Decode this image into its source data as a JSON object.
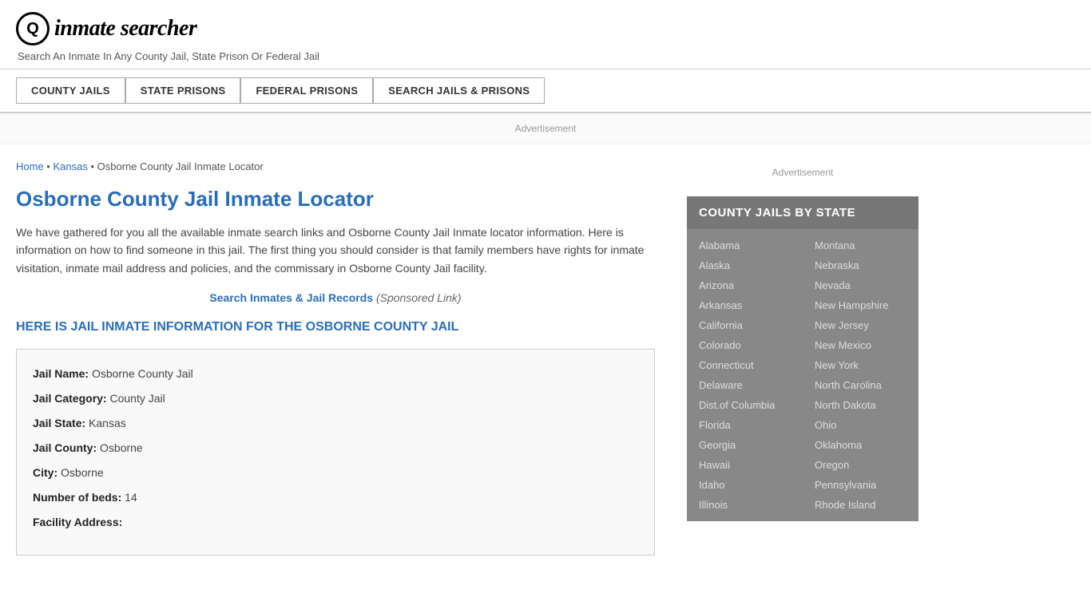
{
  "header": {
    "logo_text": "inmate searcher",
    "logo_icon": "Q",
    "tagline": "Search An Inmate In Any County Jail, State Prison Or Federal Jail"
  },
  "nav": {
    "items": [
      {
        "label": "COUNTY JAILS",
        "name": "county-jails-nav"
      },
      {
        "label": "STATE PRISONS",
        "name": "state-prisons-nav"
      },
      {
        "label": "FEDERAL PRISONS",
        "name": "federal-prisons-nav"
      },
      {
        "label": "SEARCH JAILS & PRISONS",
        "name": "search-jails-nav"
      }
    ]
  },
  "ad_label": "Advertisement",
  "breadcrumb": {
    "home": "Home",
    "state": "Kansas",
    "current": "Osborne County Jail Inmate Locator"
  },
  "page_title": "Osborne County Jail Inmate Locator",
  "body_text": "We have gathered for you all the available inmate search links and Osborne County Jail Inmate locator information. Here is information on how to find someone in this jail. The first thing you should consider is that family members have rights for inmate visitation, inmate mail address and policies, and the commissary in Osborne County Jail facility.",
  "sponsored": {
    "link_text": "Search Inmates & Jail Records",
    "tag": "(Sponsored Link)"
  },
  "section_heading": "HERE IS JAIL INMATE INFORMATION FOR THE OSBORNE COUNTY JAIL",
  "jail_info": {
    "name_label": "Jail Name:",
    "name_value": "Osborne County Jail",
    "category_label": "Jail Category:",
    "category_value": "County Jail",
    "state_label": "Jail State:",
    "state_value": "Kansas",
    "county_label": "Jail County:",
    "county_value": "Osborne",
    "city_label": "City:",
    "city_value": "Osborne",
    "beds_label": "Number of beds:",
    "beds_value": "14",
    "address_label": "Facility Address:"
  },
  "sidebar": {
    "ad_label": "Advertisement",
    "county_jails_header": "COUNTY JAILS BY STATE",
    "states_col1": [
      "Alabama",
      "Alaska",
      "Arizona",
      "Arkansas",
      "California",
      "Colorado",
      "Connecticut",
      "Delaware",
      "Dist.of Columbia",
      "Florida",
      "Georgia",
      "Hawaii",
      "Idaho",
      "Illinois"
    ],
    "states_col2": [
      "Montana",
      "Nebraska",
      "Nevada",
      "New Hampshire",
      "New Jersey",
      "New Mexico",
      "New York",
      "North Carolina",
      "North Dakota",
      "Ohio",
      "Oklahoma",
      "Oregon",
      "Pennsylvania",
      "Rhode Island"
    ]
  }
}
